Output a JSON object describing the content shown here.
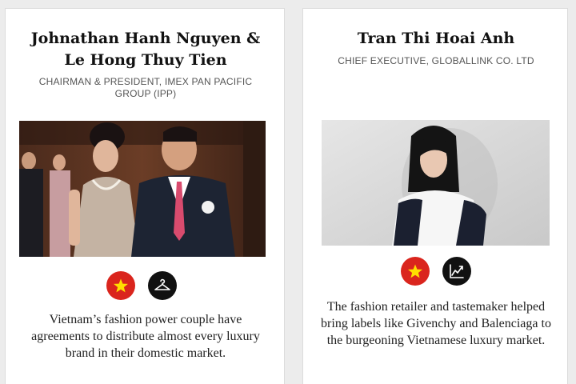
{
  "profiles": [
    {
      "name_line1": "Johnathan Hanh Nguyen &",
      "name_line2": "Le Hong Thuy Tien",
      "role": "Chairman & President, IMEX Pan Pacific Group (IPP)",
      "country_icon": "vietnam-flag-icon",
      "category_icon": "hanger-icon",
      "description": "Vietnam’s fashion power couple have agreements to distribute almost every luxury brand in their domestic market."
    },
    {
      "name_line1": "Tran Thi Hoai Anh",
      "role": "Chief Executive, GlobalLink Co. LTD",
      "country_icon": "vietnam-flag-icon",
      "category_icon": "growth-chart-icon",
      "description": "The fashion retailer and tastemaker helped bring labels like Givenchy and Balenciaga to the burgeoning Vietnamese luxury market."
    }
  ],
  "colors": {
    "flag_red": "#da251d",
    "flag_star": "#ffde00",
    "icon_dark": "#111111"
  }
}
